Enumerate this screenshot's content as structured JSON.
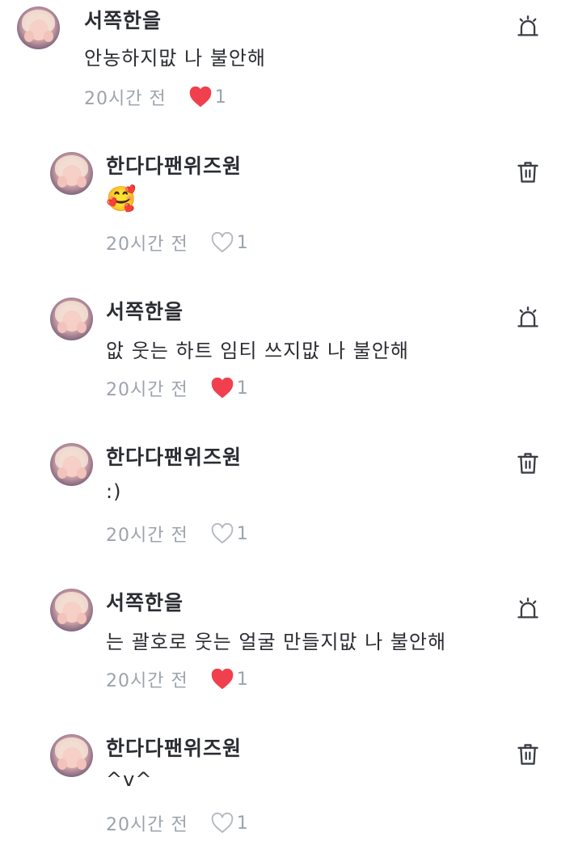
{
  "colors": {
    "heart_filled": "#f0404e",
    "heart_outline": "#b4b9c0",
    "meta_text": "#9da3ac",
    "name_text": "#2b2d33",
    "icon": "#3a3d44"
  },
  "comments": [
    {
      "author": "서쪽한을",
      "text": "안농하지맚 나 불안해",
      "emoji": "",
      "time": "20시간 전",
      "liked": true,
      "likes": "1",
      "action_icon": "report-siren-icon"
    },
    {
      "author": "한다다팬위즈원",
      "text": "",
      "emoji": "🥰",
      "time": "20시간 전",
      "liked": false,
      "likes": "1",
      "action_icon": "trash-icon"
    },
    {
      "author": "서쪽한을",
      "text": "앖 웃는 하트 임티 쓰지맚 나 불안해",
      "emoji": "",
      "time": "20시간 전",
      "liked": true,
      "likes": "1",
      "action_icon": "report-siren-icon"
    },
    {
      "author": "한다다팬위즈원",
      "text": ":)",
      "emoji": "",
      "time": "20시간 전",
      "liked": false,
      "likes": "1",
      "action_icon": "trash-icon"
    },
    {
      "author": "서쪽한을",
      "text": "는 괄호로 웃는 얼굴 만들지맚 나 불안해",
      "emoji": "",
      "time": "20시간 전",
      "liked": true,
      "likes": "1",
      "action_icon": "report-siren-icon"
    },
    {
      "author": "한다다팬위즈원",
      "text": "^v^",
      "emoji": "",
      "time": "20시간 전",
      "liked": false,
      "likes": "1",
      "action_icon": "trash-icon"
    }
  ]
}
